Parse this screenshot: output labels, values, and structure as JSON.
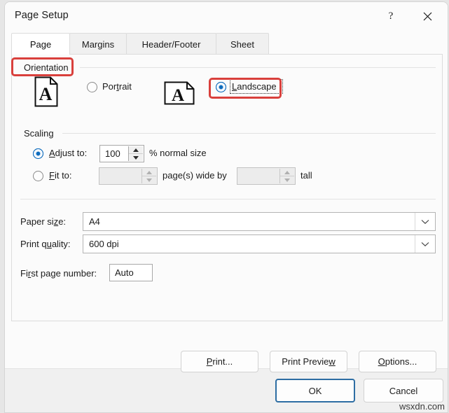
{
  "window": {
    "title": "Page Setup",
    "help_icon": "question-mark-icon",
    "close_icon": "close-icon"
  },
  "tabs": [
    {
      "label": "Page",
      "active": true
    },
    {
      "label": "Margins",
      "active": false
    },
    {
      "label": "Header/Footer",
      "active": false
    },
    {
      "label": "Sheet",
      "active": false
    }
  ],
  "orientation": {
    "group_label": "Orientation",
    "portrait": {
      "label": "Portrait",
      "acc_before": "Por",
      "acc": "t",
      "acc_after": "rait",
      "selected": false,
      "icon": "portrait-page-icon"
    },
    "landscape": {
      "label": "Landscape",
      "acc_before": "",
      "acc": "L",
      "acc_after": "andscape",
      "selected": true,
      "icon": "landscape-page-icon"
    }
  },
  "scaling": {
    "group_label": "Scaling",
    "adjust": {
      "acc_before": "",
      "acc": "A",
      "acc_after": "djust to:",
      "label": "Adjust to:",
      "selected": true,
      "value": "100",
      "suffix": "% normal size"
    },
    "fit": {
      "acc_before": "",
      "acc": "F",
      "acc_after": "it to:",
      "label": "Fit to:",
      "selected": false,
      "wide_value": "",
      "wide_suffix": "page(s) wide by",
      "tall_value": "",
      "tall_suffix": "tall",
      "disabled": true
    }
  },
  "paper": {
    "size_label": "Paper si",
    "size_acc": "z",
    "size_label_after": "e:",
    "size_value": "A4",
    "quality_label": "Print q",
    "quality_acc": "u",
    "quality_label_after": "ality:",
    "quality_value": "600 dpi",
    "dropdown_icon": "chevron-down-icon"
  },
  "first_page": {
    "label_before": "Fi",
    "label_acc": "r",
    "label_after": "st page number:",
    "label": "First page number:",
    "value": "Auto"
  },
  "actions": {
    "print": {
      "before": "",
      "acc": "P",
      "after": "rint...",
      "label": "Print..."
    },
    "print_preview": {
      "before": "Print Previe",
      "acc": "w",
      "after": "",
      "label": "Print Preview"
    },
    "options": {
      "before": "",
      "acc": "O",
      "after": "ptions...",
      "label": "Options..."
    }
  },
  "footer": {
    "ok": "OK",
    "cancel": "Cancel"
  },
  "watermark": "wsxdn.com",
  "colors": {
    "accent": "#0f6cbd",
    "annotation": "#d9403c",
    "default_button_border": "#2d6da3",
    "dialog_bg": "#fbfbfb",
    "footer_bg": "#f0f0f0"
  }
}
